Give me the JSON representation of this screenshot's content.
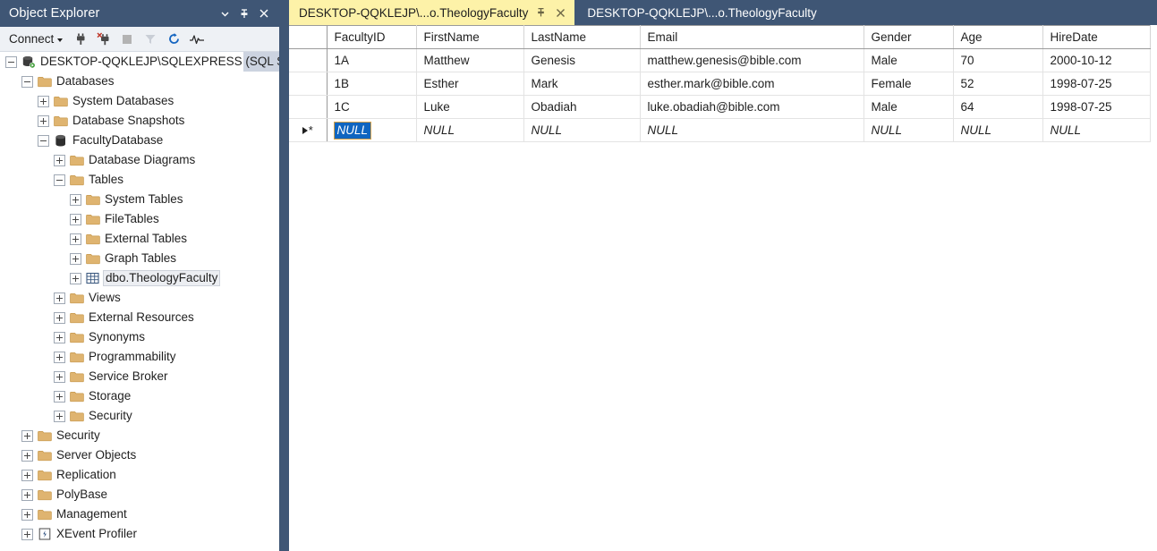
{
  "object_explorer": {
    "title": "Object Explorer",
    "window_buttons": [
      {
        "name": "dropdown",
        "icon": "chevron-down-icon"
      },
      {
        "name": "pin",
        "icon": "pin-icon"
      },
      {
        "name": "close",
        "icon": "close-icon"
      }
    ],
    "toolbar": {
      "connect_label": "Connect",
      "icons": [
        "connect-plug-icon",
        "disconnect-plug-icon",
        "stop-icon",
        "filter-icon",
        "refresh-icon",
        "activity-monitor-icon"
      ]
    },
    "tree": [
      {
        "label": "DESKTOP-QQKLEJP\\SQLEXPRESS (SQL S",
        "depth": 0,
        "icon": "server-icon",
        "state": "expanded",
        "selected": false
      },
      {
        "label": "Databases",
        "depth": 1,
        "icon": "folder-icon",
        "state": "expanded",
        "selected": false
      },
      {
        "label": "System Databases",
        "depth": 2,
        "icon": "folder-icon",
        "state": "collapsed",
        "selected": false
      },
      {
        "label": "Database Snapshots",
        "depth": 2,
        "icon": "folder-icon",
        "state": "collapsed",
        "selected": false
      },
      {
        "label": "FacultyDatabase",
        "depth": 2,
        "icon": "database-icon",
        "state": "expanded",
        "selected": false
      },
      {
        "label": "Database Diagrams",
        "depth": 3,
        "icon": "folder-icon",
        "state": "collapsed",
        "selected": false
      },
      {
        "label": "Tables",
        "depth": 3,
        "icon": "folder-icon",
        "state": "expanded",
        "selected": false
      },
      {
        "label": "System Tables",
        "depth": 4,
        "icon": "folder-icon",
        "state": "collapsed",
        "selected": false
      },
      {
        "label": "FileTables",
        "depth": 4,
        "icon": "folder-icon",
        "state": "collapsed",
        "selected": false
      },
      {
        "label": "External Tables",
        "depth": 4,
        "icon": "folder-icon",
        "state": "collapsed",
        "selected": false
      },
      {
        "label": "Graph Tables",
        "depth": 4,
        "icon": "folder-icon",
        "state": "collapsed",
        "selected": false
      },
      {
        "label": "dbo.TheologyFaculty",
        "depth": 4,
        "icon": "table-icon",
        "state": "collapsed",
        "selected": true
      },
      {
        "label": "Views",
        "depth": 3,
        "icon": "folder-icon",
        "state": "collapsed",
        "selected": false
      },
      {
        "label": "External Resources",
        "depth": 3,
        "icon": "folder-icon",
        "state": "collapsed",
        "selected": false
      },
      {
        "label": "Synonyms",
        "depth": 3,
        "icon": "folder-icon",
        "state": "collapsed",
        "selected": false
      },
      {
        "label": "Programmability",
        "depth": 3,
        "icon": "folder-icon",
        "state": "collapsed",
        "selected": false
      },
      {
        "label": "Service Broker",
        "depth": 3,
        "icon": "folder-icon",
        "state": "collapsed",
        "selected": false
      },
      {
        "label": "Storage",
        "depth": 3,
        "icon": "folder-icon",
        "state": "collapsed",
        "selected": false
      },
      {
        "label": "Security",
        "depth": 3,
        "icon": "folder-icon",
        "state": "collapsed",
        "selected": false
      },
      {
        "label": "Security",
        "depth": 1,
        "icon": "folder-icon",
        "state": "collapsed",
        "selected": false
      },
      {
        "label": "Server Objects",
        "depth": 1,
        "icon": "folder-icon",
        "state": "collapsed",
        "selected": false
      },
      {
        "label": "Replication",
        "depth": 1,
        "icon": "folder-icon",
        "state": "collapsed",
        "selected": false
      },
      {
        "label": "PolyBase",
        "depth": 1,
        "icon": "folder-icon",
        "state": "collapsed",
        "selected": false
      },
      {
        "label": "Management",
        "depth": 1,
        "icon": "folder-icon",
        "state": "collapsed",
        "selected": false
      },
      {
        "label": "XEvent Profiler",
        "depth": 1,
        "icon": "xevent-profiler-icon",
        "state": "collapsed",
        "selected": false
      }
    ]
  },
  "tabs": [
    {
      "label": "DESKTOP-QQKLEJP\\...o.TheologyFaculty",
      "active": true,
      "pin_icon": "pin-icon",
      "close_icon": "close-icon"
    },
    {
      "label": "DESKTOP-QQKLEJP\\...o.TheologyFaculty",
      "active": false
    }
  ],
  "grid": {
    "columns": [
      "FacultyID",
      "FirstName",
      "LastName",
      "Email",
      "Gender",
      "Age",
      "HireDate"
    ],
    "rows": [
      {
        "FacultyID": "1A",
        "FirstName": "Matthew",
        "LastName": "Genesis",
        "Email": "matthew.genesis@bible.com",
        "Gender": "Male",
        "Age": "70",
        "HireDate": "2000-10-12",
        "is_new_row": false
      },
      {
        "FacultyID": "1B",
        "FirstName": "Esther",
        "LastName": "Mark",
        "Email": "esther.mark@bible.com",
        "Gender": "Female",
        "Age": "52",
        "HireDate": "1998-07-25",
        "is_new_row": false
      },
      {
        "FacultyID": "1C",
        "FirstName": "Luke",
        "LastName": "Obadiah",
        "Email": "luke.obadiah@bible.com",
        "Gender": "Male",
        "Age": "64",
        "HireDate": "1998-07-25",
        "is_new_row": false
      },
      {
        "FacultyID": "NULL",
        "FirstName": "NULL",
        "LastName": "NULL",
        "Email": "NULL",
        "Gender": "NULL",
        "Age": "NULL",
        "HireDate": "NULL",
        "is_new_row": true
      }
    ],
    "selected_cell": {
      "row": 3,
      "column": "FacultyID",
      "value": "NULL"
    },
    "new_row_marker": "new-row-indicator"
  },
  "colors": {
    "chrome_blue": "#3f5675",
    "active_tab_yellow": "#fdf2a8",
    "selection_blue": "#0f65c0",
    "selection_border": "#d8a349",
    "folder_tan": "#dfb470"
  }
}
